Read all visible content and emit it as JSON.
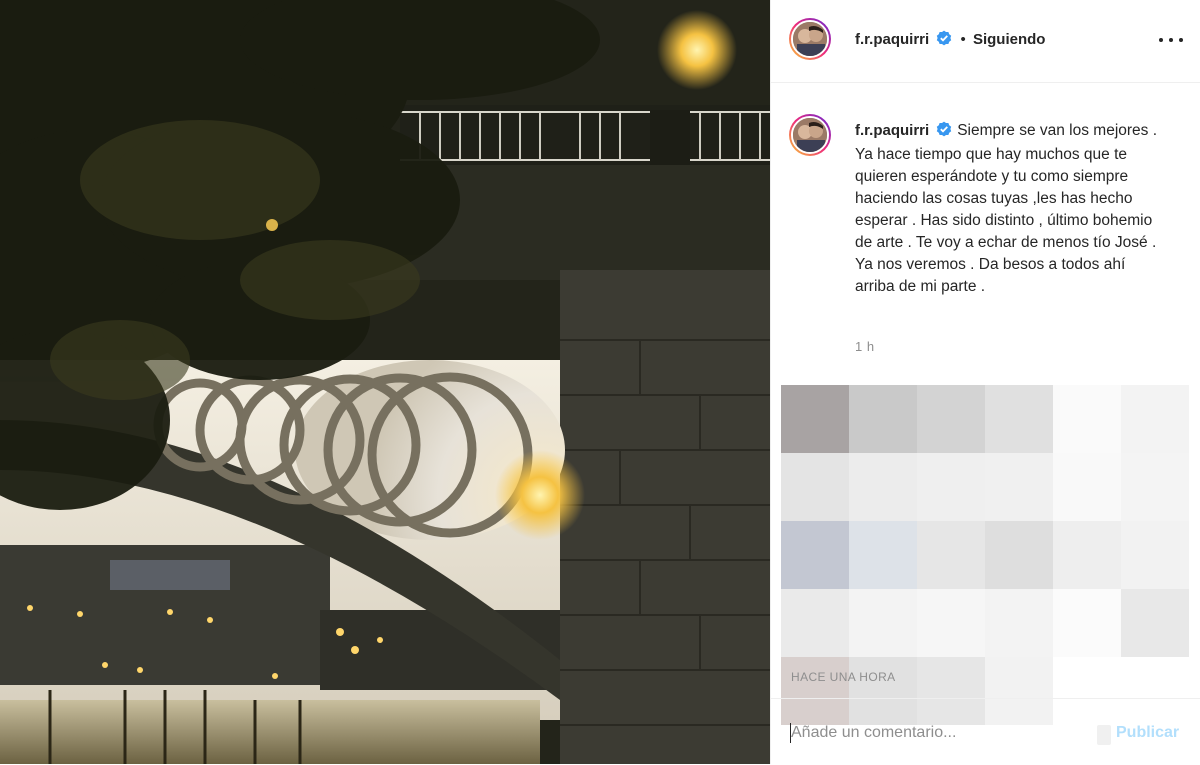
{
  "post": {
    "username": "f.r.paquirri",
    "follow_separator": "•",
    "follow_state": "Siguiendo",
    "caption": "Siempre se van los mejores . Ya hace tiempo que hay muchos que te quieren esperándote y tu como siempre haciendo las cosas tuyas ,les has hecho esperar . Has sido distinto , último bohemio de arte . Te voy a echar de menos tío José . Ya nos veremos . Da besos a todos ahí arriba de mi parte .",
    "caption_time": "1 h",
    "posted_ago": "HACE UNA HORA"
  },
  "comment_box": {
    "placeholder": "Añade un comentario...",
    "publish_label": "Publicar"
  },
  "colors": {
    "verified": "#3897f0",
    "publish_disabled": "#b2dffc",
    "muted_text": "#8e8e8e"
  },
  "icons": [
    "verified-badge-icon",
    "more-options-icon"
  ],
  "pixel_block": {
    "colors": [
      [
        "#a8a3a3",
        "#c9c9c9",
        "#d3d3d3",
        "#e0e0e0",
        "#fafafa",
        "#f3f3f3"
      ],
      [
        "#e4e4e4",
        "#ececec",
        "#efefef",
        "#f0f0f0",
        "#f9f9f9",
        "#f4f4f4"
      ],
      [
        "#c3c7d2",
        "#dde2e8",
        "#e6e6e6",
        "#dedede",
        "#eeeeee",
        "#f2f2f2"
      ],
      [
        "#eaeaea",
        "#f3f3f3",
        "#f6f6f6",
        "#f3f3f3",
        "#fbfbfb",
        "#e8e8e8"
      ],
      [
        "#d8cfcd",
        "#e1e1e1",
        "#e6e6e6",
        "#f2f2f2",
        "#ffffff",
        "#ffffff"
      ]
    ]
  }
}
